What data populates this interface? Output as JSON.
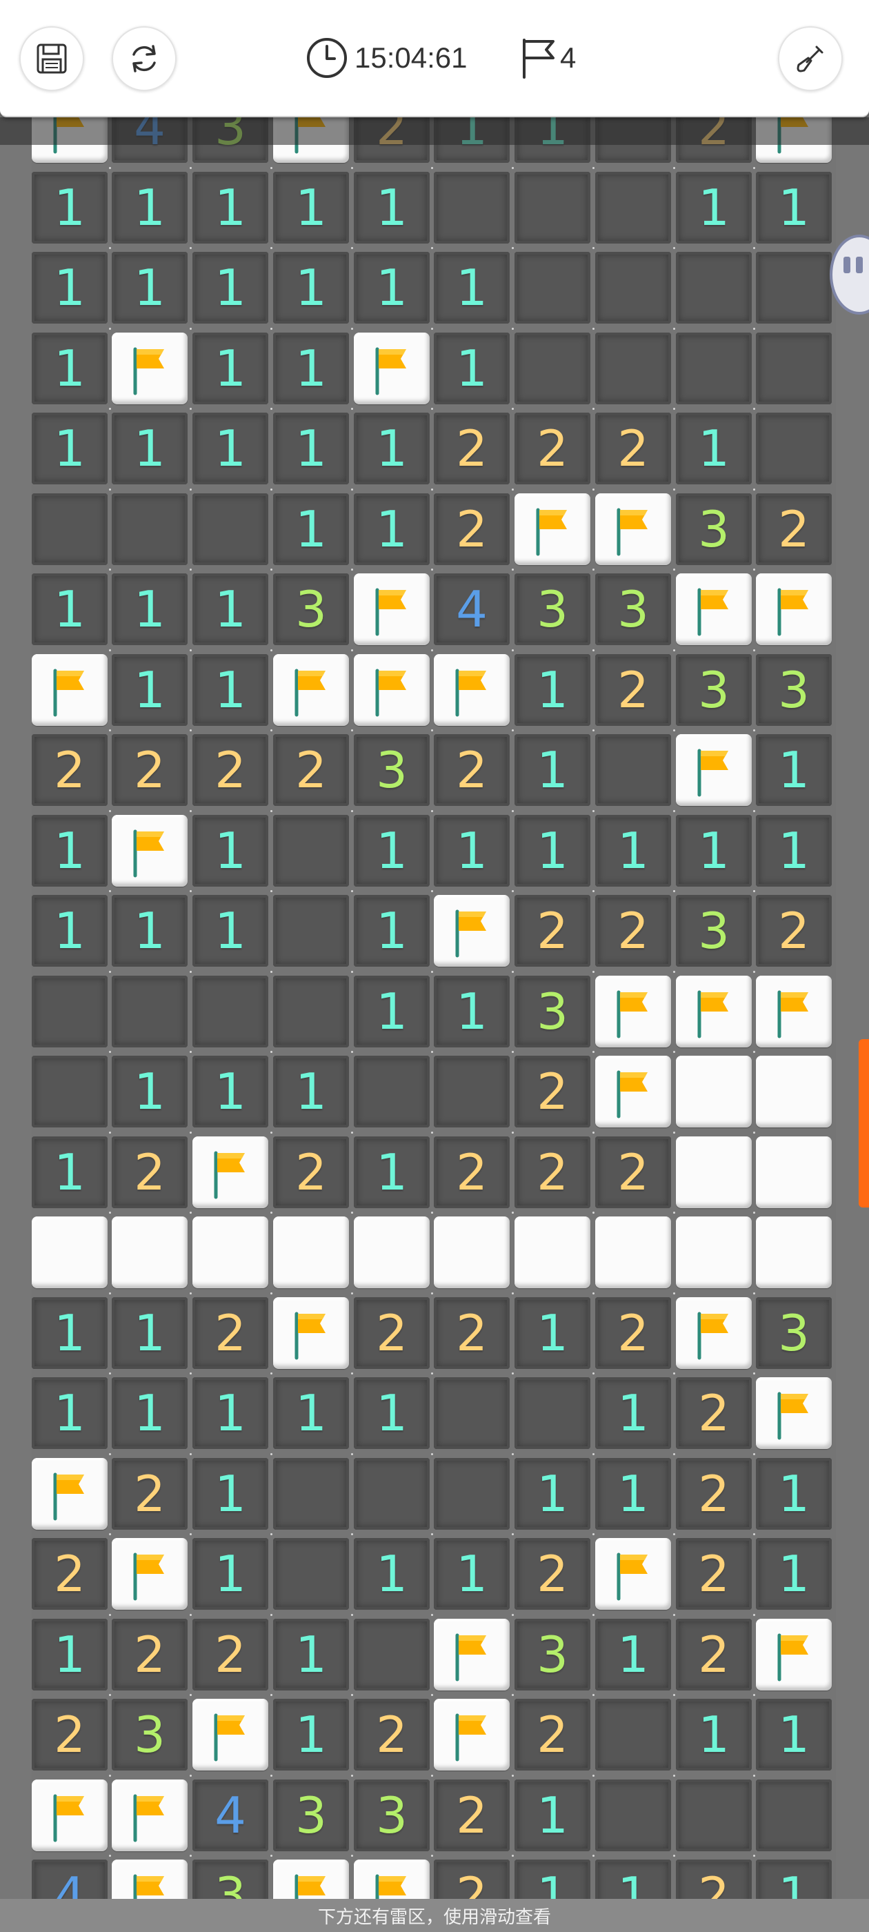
{
  "toolbar": {
    "save_button": "save",
    "restart_button": "restart",
    "timer": "15:04:61",
    "flag_count": "4",
    "tool_button": "shovel"
  },
  "icons": {
    "save": "floppy-disk-icon",
    "restart": "refresh-icon",
    "timer": "clock-icon",
    "flags": "flag-outline-icon",
    "tool": "shovel-icon",
    "cell_flag": "orange-flag-icon"
  },
  "colors": {
    "n1": "#6ff5d8",
    "n2": "#ffd37a",
    "n3": "#b4ef6a",
    "n4": "#5b9ee8",
    "flag": "#ffb300",
    "revealed": "#565656",
    "covered": "#fbfbfb",
    "accent_tab": "#ff6a13"
  },
  "board": {
    "columns": 10,
    "rows_visible": [
      "F43F211.2F",
      "11111...11",
      "111111....",
      "1F11F1....",
      "111112221.",
      "...112FF32",
      "1113F433FF",
      "F11FFF1233",
      "2222321.F1",
      "1F1.111111",
      "111.1F2232",
      "....113FFF",
      ".111..2F##",
      "12F21222##",
      "##########",
      "112F2212F3",
      "11111..12F",
      "F21...1121",
      "2F1.112F21",
      "1221-F312F",
      "23F12F2.11",
      "FF43321...",
      "4F3FF21121"
    ],
    "legend": "digits = adjacent mine count, F = flagged, . = revealed empty, # = covered"
  },
  "bottom_hint": "下方还有雷区，使用滑动查看"
}
